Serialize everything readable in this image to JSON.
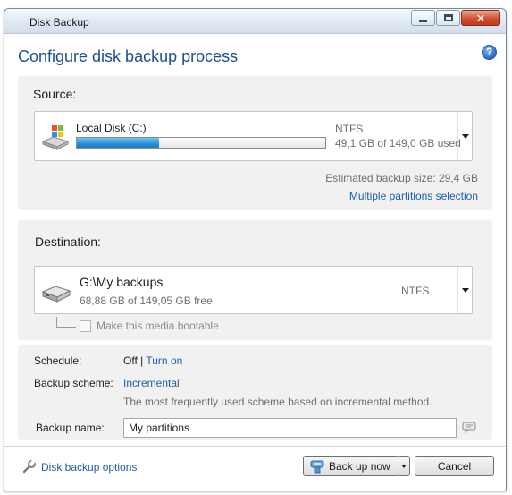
{
  "window": {
    "title": "Disk Backup",
    "minimize_icon": "minimize-icon",
    "maximize_icon": "maximize-icon",
    "close_icon": "close-icon",
    "close_glyph": "✕"
  },
  "header": {
    "title": "Configure disk backup process",
    "help_icon": "help-icon",
    "help_glyph": "?"
  },
  "source": {
    "label": "Source:",
    "disk_name": "Local Disk (C:)",
    "disk_icon": "windows-drive-icon",
    "filesystem": "NTFS",
    "usage_text": "49,1 GB of 149,0 GB used",
    "usage_fraction": 0.33,
    "estimated_size": "Estimated backup size: 29,4 GB",
    "multiple_partitions_link": "Multiple partitions selection"
  },
  "destination": {
    "label": "Destination:",
    "path": "G:\\My backups",
    "free_text": "68,88 GB of 149,05 GB free",
    "filesystem": "NTFS",
    "drive_icon": "hard-drive-icon",
    "bootable_label": "Make this media bootable",
    "bootable_checked": false
  },
  "options": {
    "schedule_label": "Schedule:",
    "schedule_value": "Off",
    "schedule_separator": " | ",
    "schedule_link": "Turn on",
    "scheme_label": "Backup scheme:",
    "scheme_link": "Incremental",
    "scheme_description": "The most frequently used scheme based on incremental method.",
    "name_label": "Backup name:",
    "name_value": "My partitions",
    "comment_icon": "comment-icon"
  },
  "footer": {
    "options_link": "Disk backup options",
    "options_icon": "wrench-icon",
    "backup_button": "Back up now",
    "backup_icon": "backup-icon",
    "cancel_button": "Cancel"
  },
  "colors": {
    "title_blue": "#1d4f91",
    "link_blue": "#1d5ea8",
    "panel_bg": "#f1f1f1",
    "progress_blue": "#2a8fd3"
  }
}
